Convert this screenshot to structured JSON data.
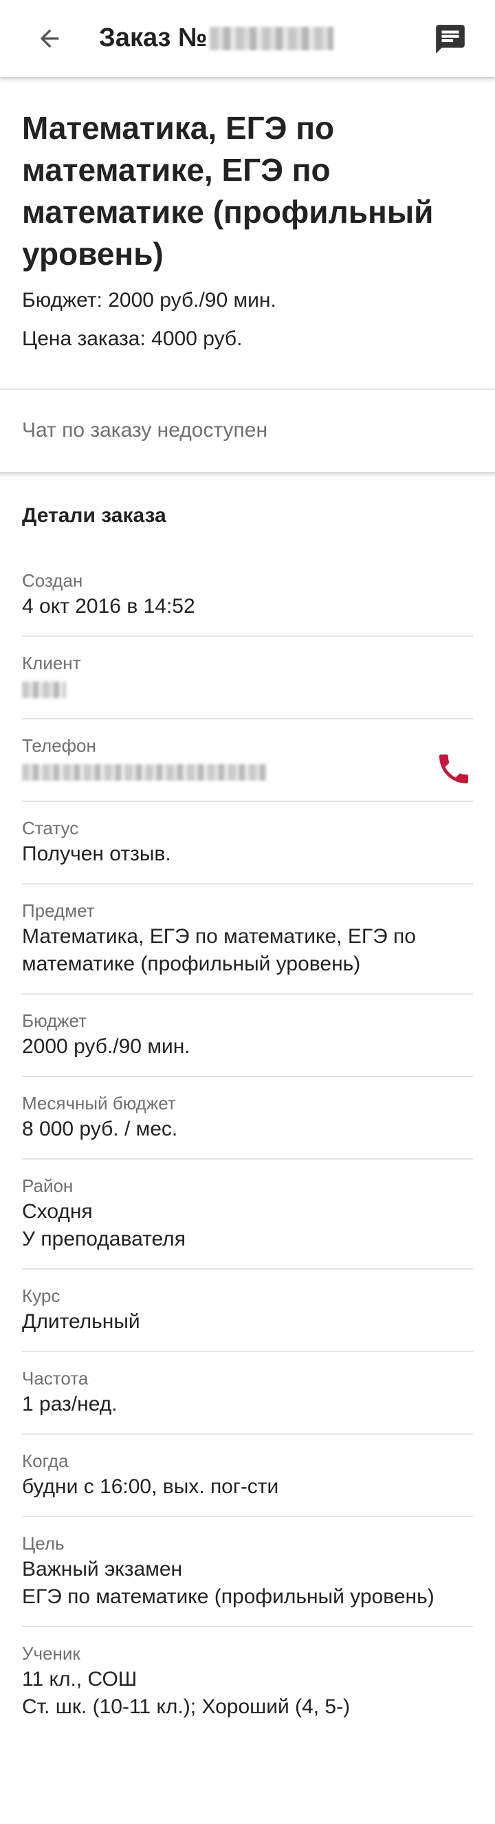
{
  "appbar": {
    "title_prefix": "Заказ №",
    "back_icon": "arrow-left-icon",
    "chat_icon": "message-icon"
  },
  "order": {
    "subject_title": "Математика, ЕГЭ по математике, ЕГЭ по математике (профильный уровень)",
    "budget_line": "Бюджет: 2000 руб./90 мин.",
    "price_line": "Цена заказа: 4000 руб."
  },
  "chat_status": "Чат по заказу недоступен",
  "details": {
    "title": "Детали заказа",
    "rows": [
      {
        "label": "Создан",
        "lines": [
          "4 окт 2016 в 14:52"
        ]
      },
      {
        "label": "Клиент",
        "lines": []
      },
      {
        "label": "Телефон",
        "lines": []
      },
      {
        "label": "Статус",
        "lines": [
          "Получен отзыв."
        ]
      },
      {
        "label": "Предмет",
        "lines": [
          "Математика, ЕГЭ по математике, ЕГЭ по",
          "математике (профильный уровень)"
        ]
      },
      {
        "label": "Бюджет",
        "lines": [
          "2000 руб./90 мин."
        ]
      },
      {
        "label": "Месячный бюджет",
        "lines": [
          "8 000 руб. / мес."
        ]
      },
      {
        "label": "Район",
        "lines": [
          "Сходня",
          "У преподавателя"
        ]
      },
      {
        "label": "Курс",
        "lines": [
          "Длительный"
        ]
      },
      {
        "label": "Частота",
        "lines": [
          "1 раз/нед."
        ]
      },
      {
        "label": "Когда",
        "lines": [
          "будни с 16:00, вых. пог-сти"
        ]
      },
      {
        "label": "Цель",
        "lines": [
          "Важный экзамен",
          "ЕГЭ по математике (профильный уровень)"
        ]
      },
      {
        "label": "Ученик",
        "lines": [
          "11 кл., СОШ",
          "Ст. шк. (10-11 кл.); Хороший (4, 5-)"
        ]
      }
    ]
  },
  "colors": {
    "phone_icon": "#c2183a",
    "label_text": "#707070",
    "divider": "#e4e4e4"
  }
}
